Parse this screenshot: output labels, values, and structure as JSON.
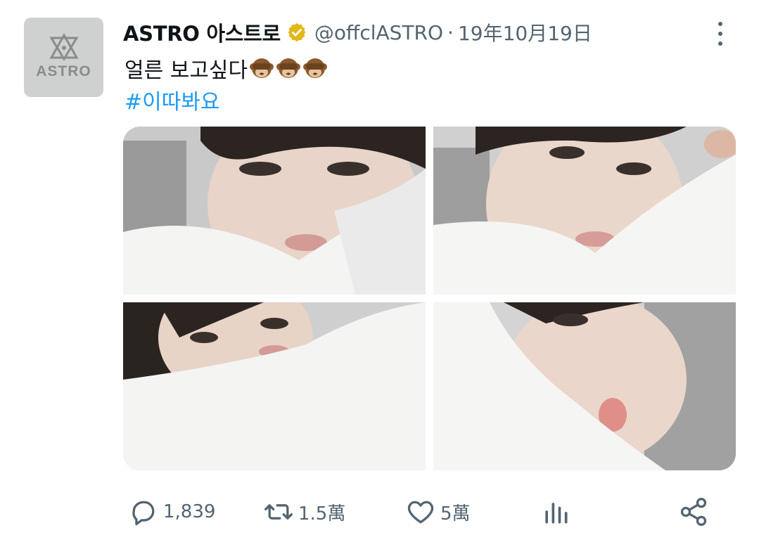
{
  "tweet": {
    "avatar_text": "ASTRO",
    "display_name": "ASTRO 아스트로",
    "handle": "@offclASTRO",
    "separator": "·",
    "date": "19年10月19日",
    "text": "얼른 보고싶다",
    "emoji_count": 3,
    "hashtag": "#이따봐요",
    "photos": [
      {
        "alt": "selfie 1"
      },
      {
        "alt": "selfie 2"
      },
      {
        "alt": "selfie 3"
      },
      {
        "alt": "selfie 4"
      }
    ]
  },
  "actions": {
    "replies": "1,839",
    "retweets": "1.5萬",
    "likes": "5萬"
  },
  "colors": {
    "accent": "#1d9bf0",
    "muted": "#536471",
    "text": "#0f1419",
    "verified": "#e2b719",
    "avatar_bg": "#cfd1d1"
  },
  "icons": [
    "astro-logo-icon",
    "verified-badge-icon",
    "more-options-icon",
    "see-no-evil-monkey-icon",
    "reply-icon",
    "retweet-icon",
    "like-icon",
    "views-icon",
    "share-icon"
  ]
}
